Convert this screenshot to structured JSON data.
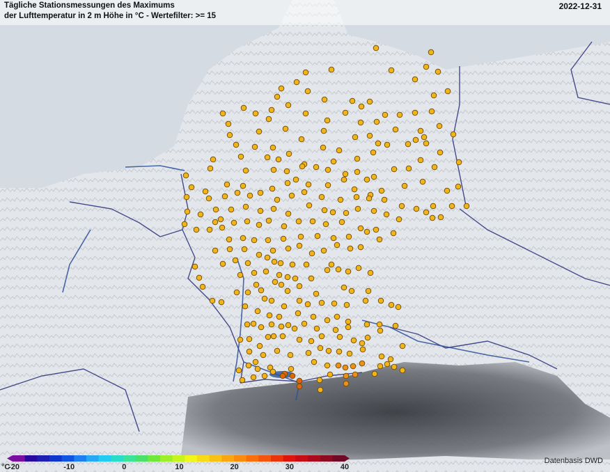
{
  "header": {
    "title_line1": "Tägliche Stationsmessungen des Maximums",
    "title_line2": "der Lufttemperatur in 2 m Höhe in °C - Wertefilter: >= 15",
    "date": "2022-12-31"
  },
  "footer": {
    "source": "Datenbasis DWD"
  },
  "legend": {
    "unit": "°C",
    "min": -20,
    "max": 40,
    "ticks": [
      "-20",
      "-10",
      "0",
      "10",
      "20",
      "30",
      "40"
    ],
    "colors": [
      "#7b0fa0",
      "#2a0a9c",
      "#1d1fb3",
      "#0c36cc",
      "#0f55e2",
      "#1f7ff0",
      "#27a8f5",
      "#22ccf0",
      "#27dcc8",
      "#3ae29a",
      "#4be06a",
      "#6ee83b",
      "#9cef29",
      "#c8f41d",
      "#f2f51a",
      "#f7db16",
      "#f9c113",
      "#f9a610",
      "#f98c0e",
      "#f7700c",
      "#f4540b",
      "#ea340b",
      "#df150c",
      "#c70c14",
      "#ac0a1c",
      "#8d0a22",
      "#700926"
    ]
  },
  "colors": {
    "station_fill": "#f3b31a",
    "station_fill_warm": "#f08e1a",
    "station_fill_hot": "#e0660e",
    "station_stroke": "#6a4a00",
    "border": "#2a2f7a",
    "river": "#2a4f9a",
    "land": "#e6e8eb",
    "water": "#cfd8e2",
    "alps_dark": "#3a3d42"
  }
}
